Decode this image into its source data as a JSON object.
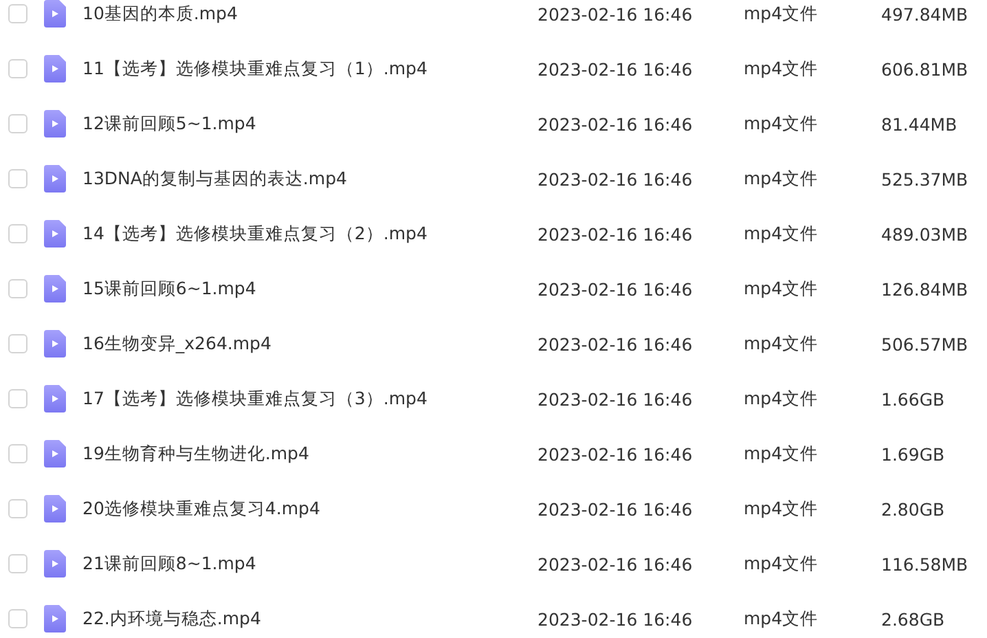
{
  "files": [
    {
      "name": "10基因的本质.mp4",
      "date": "2023-02-16 16:46",
      "type": "mp4文件",
      "size": "497.84MB",
      "checked": false
    },
    {
      "name": "11【选考】选修模块重难点复习（1）.mp4",
      "date": "2023-02-16 16:46",
      "type": "mp4文件",
      "size": "606.81MB",
      "checked": false
    },
    {
      "name": "12课前回顾5~1.mp4",
      "date": "2023-02-16 16:46",
      "type": "mp4文件",
      "size": "81.44MB",
      "checked": false
    },
    {
      "name": "13DNA的复制与基因的表达.mp4",
      "date": "2023-02-16 16:46",
      "type": "mp4文件",
      "size": "525.37MB",
      "checked": false
    },
    {
      "name": "14【选考】选修模块重难点复习（2）.mp4",
      "date": "2023-02-16 16:46",
      "type": "mp4文件",
      "size": "489.03MB",
      "checked": false
    },
    {
      "name": "15课前回顾6~1.mp4",
      "date": "2023-02-16 16:46",
      "type": "mp4文件",
      "size": "126.84MB",
      "checked": false
    },
    {
      "name": "16生物变异_x264.mp4",
      "date": "2023-02-16 16:46",
      "type": "mp4文件",
      "size": "506.57MB",
      "checked": false
    },
    {
      "name": "17【选考】选修模块重难点复习（3）.mp4",
      "date": "2023-02-16 16:46",
      "type": "mp4文件",
      "size": "1.66GB",
      "checked": false
    },
    {
      "name": "19生物育种与生物进化.mp4",
      "date": "2023-02-16 16:46",
      "type": "mp4文件",
      "size": "1.69GB",
      "checked": false
    },
    {
      "name": "20选修模块重难点复习4.mp4",
      "date": "2023-02-16 16:46",
      "type": "mp4文件",
      "size": "2.80GB",
      "checked": false
    },
    {
      "name": "21课前回顾8~1.mp4",
      "date": "2023-02-16 16:46",
      "type": "mp4文件",
      "size": "116.58MB",
      "checked": false
    },
    {
      "name": "22.内环境与稳态.mp4",
      "date": "2023-02-16 16:46",
      "type": "mp4文件",
      "size": "2.68GB",
      "checked": false
    }
  ]
}
